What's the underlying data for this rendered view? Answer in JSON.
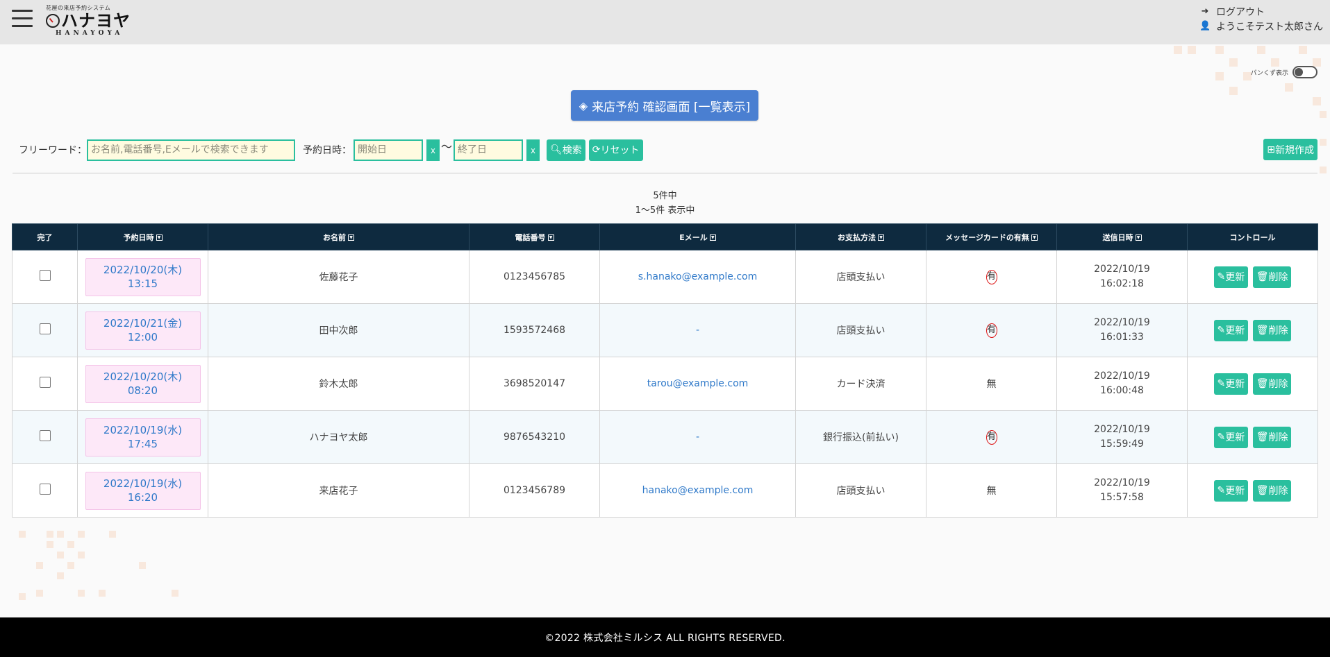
{
  "header": {
    "logo_sub": "花屋の来店予約システム",
    "logo_main": "ハナヨヤ",
    "logo_roman": "HANAYOYA",
    "logout_label": "ログアウト",
    "welcome_label": "ようこそテスト太郎さん"
  },
  "toggle": {
    "label": "パンくず表示",
    "on": false
  },
  "title": {
    "label": "来店予約 確認画面 [一覧表示]"
  },
  "search": {
    "freeword_label": "フリーワード：",
    "freeword_placeholder": "お名前,電話番号,Eメールで検索できます",
    "date_label": "予約日時：",
    "start_placeholder": "開始日",
    "end_placeholder": "終了日",
    "clear_label": "x",
    "tilde": "～",
    "search_label": "検索",
    "reset_label": "リセット",
    "new_label": "新規作成"
  },
  "count": {
    "total": "5件中",
    "range": "1～5件 表示中"
  },
  "table": {
    "headers": [
      "完了",
      "予約日時",
      "お名前",
      "電話番号",
      "Eメール",
      "お支払方法",
      "メッセージカードの有無",
      "送信日時",
      "コントロール"
    ],
    "update_label": "更新",
    "delete_label": "削除",
    "rows": [
      {
        "date": "2022/10/20(木)",
        "time": "13:15",
        "name": "佐藤花子",
        "phone": "0123456785",
        "email": "s.hanako@example.com",
        "payment": "店頭支払い",
        "card": "有",
        "sent_date": "2022/10/19",
        "sent_time": "16:02:18"
      },
      {
        "date": "2022/10/21(金)",
        "time": "12:00",
        "name": "田中次郎",
        "phone": "1593572468",
        "email": "-",
        "payment": "店頭支払い",
        "card": "有",
        "sent_date": "2022/10/19",
        "sent_time": "16:01:33"
      },
      {
        "date": "2022/10/20(木)",
        "time": "08:20",
        "name": "鈴木太郎",
        "phone": "3698520147",
        "email": "tarou@example.com",
        "payment": "カード決済",
        "card": "無",
        "sent_date": "2022/10/19",
        "sent_time": "16:00:48"
      },
      {
        "date": "2022/10/19(水)",
        "time": "17:45",
        "name": "ハナヨヤ太郎",
        "phone": "9876543210",
        "email": "-",
        "payment": "銀行振込(前払い)",
        "card": "有",
        "sent_date": "2022/10/19",
        "sent_time": "15:59:49"
      },
      {
        "date": "2022/10/19(水)",
        "time": "16:20",
        "name": "来店花子",
        "phone": "0123456789",
        "email": "hanako@example.com",
        "payment": "店頭支払い",
        "card": "無",
        "sent_date": "2022/10/19",
        "sent_time": "15:57:58"
      }
    ]
  },
  "footer": {
    "text": "©2022 株式会社ミルシス ALL RIGHTS RESERVED."
  },
  "colors": {
    "accent": "#2abf9e",
    "title_bg": "#4a7fd1",
    "table_header": "#0e2a3f",
    "header_bg": "#e6e6e6",
    "footer_bg": "#000000"
  }
}
